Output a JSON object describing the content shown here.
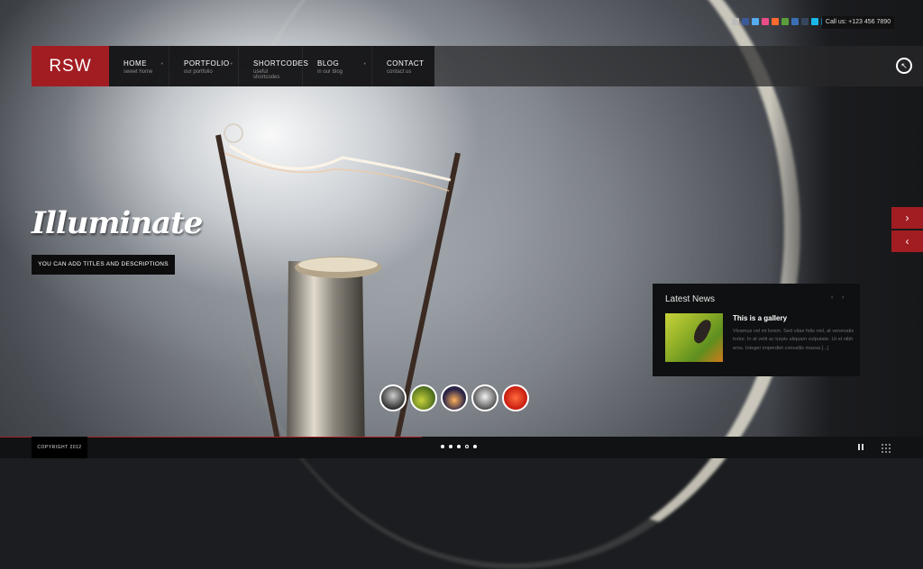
{
  "logo": "RSW",
  "menu": [
    {
      "title": "HOME",
      "sub": "sweet home"
    },
    {
      "title": "PORTFOLIO",
      "sub": "our portfolio"
    },
    {
      "title": "SHORTCODES",
      "sub": "useful shortcodes"
    },
    {
      "title": "BLOG",
      "sub": "in our blog"
    },
    {
      "title": "CONTACT",
      "sub": "contact us"
    }
  ],
  "contact_phone": "Call us: +123 456 7890",
  "social_icons": [
    "add-icon",
    "facebook-icon",
    "twitter-icon",
    "dribbble-icon",
    "flickr-icon",
    "lastfm-icon",
    "myspace-icon",
    "tumblr-icon",
    "vimeo-icon",
    "linkedin-icon"
  ],
  "caption": {
    "title": "Illuminate",
    "subtitle": "YOU CAN ADD TITLES AND DESCRIPTIONS"
  },
  "news": {
    "heading": "Latest News",
    "item_title": "This is a gallery",
    "item_body": "Vivamus vel mi lorem. Sed vitae felis nisl, at venenatis tortor. In at velit ac turpis aliquam vulputate. Ut et nibh eros. Integer imperdiet convallis massa [...]"
  },
  "copyright": "COPYRIGHT 2012",
  "slides": {
    "count": 5,
    "active_index": 3
  },
  "colors": {
    "accent": "#a21d22"
  }
}
